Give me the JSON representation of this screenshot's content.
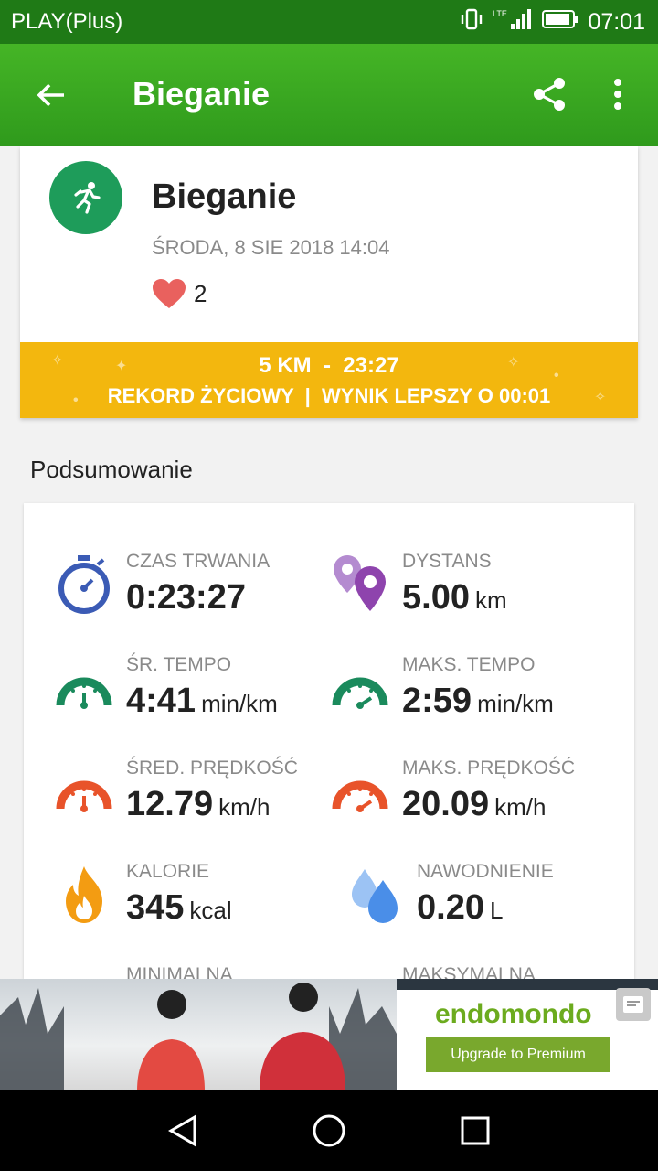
{
  "status_bar": {
    "carrier": "PLAY(Plus)",
    "network": "LTE",
    "time": "07:01"
  },
  "app_bar": {
    "title": "Bieganie",
    "back_icon": "arrow-left-icon",
    "share_icon": "share-icon",
    "more_icon": "more-vertical-icon"
  },
  "workout": {
    "sport": "Bieganie",
    "date": "ŚRODA, 8 SIE 2018 14:04",
    "likes": "2",
    "record": {
      "line1": "5 KM  -  23:27",
      "line2": "REKORD ŻYCIOWY  |  WYNIK LEPSZY O 00:01"
    }
  },
  "summary": {
    "title": "Podsumowanie",
    "stats": [
      {
        "label": "CZAS TRWANIA",
        "value": "0:23:27",
        "unit": "",
        "icon": "stopwatch-icon"
      },
      {
        "label": "DYSTANS",
        "value": "5.00",
        "unit": "km",
        "icon": "map-pin-icon"
      },
      {
        "label": "ŚR. TEMPO",
        "value": "4:41",
        "unit": "min/km",
        "icon": "gauge-icon"
      },
      {
        "label": "MAKS. TEMPO",
        "value": "2:59",
        "unit": "min/km",
        "icon": "gauge-icon"
      },
      {
        "label": "ŚRED. PRĘDKOŚĆ",
        "value": "12.79",
        "unit": "km/h",
        "icon": "speedometer-icon"
      },
      {
        "label": "MAKS. PRĘDKOŚĆ",
        "value": "20.09",
        "unit": "km/h",
        "icon": "speedometer-icon"
      },
      {
        "label": "KALORIE",
        "value": "345",
        "unit": "kcal",
        "icon": "flame-icon"
      },
      {
        "label": "NAWODNIENIE",
        "value": "0.20",
        "unit": "L",
        "icon": "water-drops-icon"
      }
    ],
    "partial_labels": [
      "MINIMALNA",
      "MAKSYMALNA"
    ]
  },
  "ad": {
    "brand": "endomondo",
    "cta": "Upgrade to Premium"
  },
  "colors": {
    "green": "#2f9a1c",
    "gold": "#f3b70e",
    "run_green": "#1e9c5a",
    "blue": "#3b5bb5",
    "purple": "#8e44ad",
    "teal": "#1a8a5c",
    "orange_red": "#e8532a",
    "orange": "#f39c12",
    "sky": "#4a8ee8"
  }
}
